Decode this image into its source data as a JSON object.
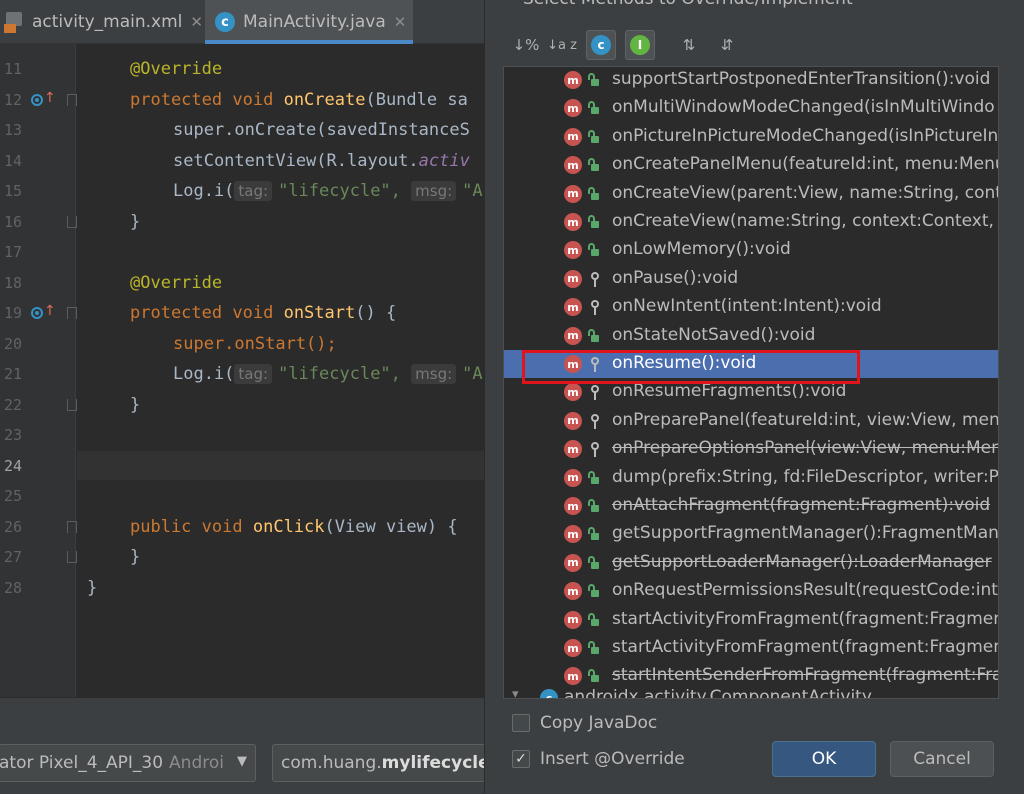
{
  "tabs": [
    {
      "label": "activity_main.xml",
      "close": "✕"
    },
    {
      "label": "MainActivity.java",
      "close": "✕",
      "icon_letter": "c"
    }
  ],
  "editor": {
    "line_numbers": [
      "11",
      "12",
      "13",
      "14",
      "15",
      "16",
      "17",
      "18",
      "19",
      "20",
      "21",
      "22",
      "23",
      "24",
      "25",
      "26",
      "27",
      "28"
    ],
    "current_line": "24",
    "annotation": "@Override",
    "protected": "protected",
    "void": "void",
    "public": "public",
    "on_create": "onCreate",
    "on_create_params": "(Bundle sa",
    "super_on_create": "super.onCreate(savedInstanceS",
    "set_content_view_a": "setContentView(R.layout.",
    "set_content_view_b": "activ",
    "log_i": "Log.i(",
    "tag_hint": "tag:",
    "tag_value": "\"lifecycle\",",
    "msg_hint": "msg:",
    "msg_value": "\"A",
    "on_start": "onStart",
    "on_start_params": "() {",
    "super_on_start": "super.onStart();",
    "on_click": "onClick",
    "on_click_params": "(View view) {",
    "close_brace": "}"
  },
  "bottom_bar": {
    "device_text": "ator Pixel_4_API_30",
    "device_suffix": "Androi",
    "package_prefix": "com.huang.",
    "package_bold": "mylifecycle"
  },
  "dialog": {
    "title": "Select Methods to Override/Implement",
    "toolbar": [
      "↓%",
      "↓a z",
      "c",
      "I",
      "⇅",
      "⇵"
    ],
    "methods": [
      {
        "label": "supportStartPostponedEnterTransition():void",
        "vis": "public",
        "deprecated": false
      },
      {
        "label": "onMultiWindowModeChanged(isInMultiWindo",
        "vis": "public",
        "deprecated": false
      },
      {
        "label": "onPictureInPictureModeChanged(isInPictureIn",
        "vis": "public",
        "deprecated": false
      },
      {
        "label": "onCreatePanelMenu(featureId:int, menu:Menu",
        "vis": "public",
        "deprecated": false
      },
      {
        "label": "onCreateView(parent:View, name:String, conte",
        "vis": "public",
        "deprecated": false
      },
      {
        "label": "onCreateView(name:String, context:Context, a",
        "vis": "public",
        "deprecated": false
      },
      {
        "label": "onLowMemory():void",
        "vis": "public",
        "deprecated": false
      },
      {
        "label": "onPause():void",
        "vis": "protected",
        "deprecated": false
      },
      {
        "label": "onNewIntent(intent:Intent):void",
        "vis": "protected",
        "deprecated": false
      },
      {
        "label": "onStateNotSaved():void",
        "vis": "public",
        "deprecated": false
      },
      {
        "label": "onResume():void",
        "vis": "protected",
        "deprecated": false,
        "selected": true
      },
      {
        "label": "onResumeFragments():void",
        "vis": "protected",
        "deprecated": false
      },
      {
        "label": "onPreparePanel(featureId:int, view:View, menu",
        "vis": "protected",
        "deprecated": false
      },
      {
        "label": "onPrepareOptionsPanel(view:View, menu:Men",
        "vis": "protected",
        "deprecated": true
      },
      {
        "label": "dump(prefix:String, fd:FileDescriptor, writer:Pr",
        "vis": "public",
        "deprecated": false
      },
      {
        "label": "onAttachFragment(fragment:Fragment):void",
        "vis": "public",
        "deprecated": true
      },
      {
        "label": "getSupportFragmentManager():FragmentMan",
        "vis": "public",
        "deprecated": false
      },
      {
        "label": "getSupportLoaderManager():LoaderManager",
        "vis": "public",
        "deprecated": true
      },
      {
        "label": "onRequestPermissionsResult(requestCode:int",
        "vis": "public",
        "deprecated": false
      },
      {
        "label": "startActivityFromFragment(fragment:Fragmen",
        "vis": "public",
        "deprecated": false
      },
      {
        "label": "startActivityFromFragment(fragment:Fragmen",
        "vis": "public",
        "deprecated": false
      },
      {
        "label": "startIntentSenderFromFragment(fragment:Fra",
        "vis": "public",
        "deprecated": true
      }
    ],
    "group_footer": "androidx.activity.ComponentActivity",
    "copy_javadoc": {
      "label": "Copy JavaDoc",
      "checked": false
    },
    "insert_override": {
      "label": "Insert @Override",
      "checked": true
    },
    "ok_label": "OK",
    "cancel_label": "Cancel"
  },
  "colors": {
    "selection": "#4b6eaf",
    "highlight_box": "#e0141d",
    "method_icon": "#c75450",
    "class_icon": "#3592c4"
  }
}
